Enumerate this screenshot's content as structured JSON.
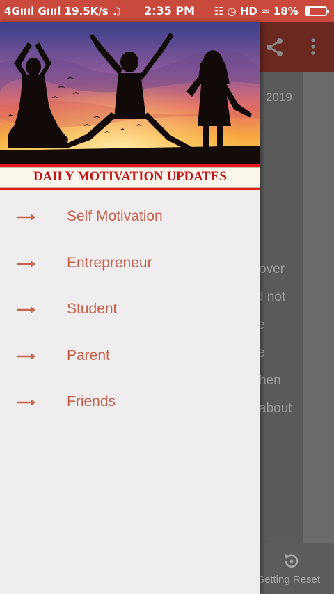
{
  "status_bar": {
    "network_left": "4Gıııl Gıııl 19.5K/s ♫",
    "time": "2:35 PM",
    "indicators": "HD",
    "battery": "18%",
    "battery_level": 0.18
  },
  "background_screen": {
    "date_fragment": "2019",
    "text_fragments": [
      "over",
      "d  not",
      "e",
      "e",
      "hen",
      "about"
    ],
    "bottom_action_label": "Setting Reset"
  },
  "drawer": {
    "banner_title": "DAILY MOTIVATION UPDATES",
    "menu_items": [
      {
        "label": "Self Motivation",
        "icon": "arrow-right-icon"
      },
      {
        "label": "Entrepreneur",
        "icon": "arrow-right-icon"
      },
      {
        "label": "Student",
        "icon": "arrow-right-icon"
      },
      {
        "label": "Parent",
        "icon": "arrow-right-icon"
      },
      {
        "label": "Friends",
        "icon": "arrow-right-icon"
      }
    ]
  },
  "colors": {
    "status_bar": "#c94a3c",
    "toolbar_dimmed": "#6a2920",
    "banner_red": "#e41a1a",
    "banner_text": "#c4121b",
    "menu_text": "#c9604a",
    "drawer_bg": "#efeded"
  }
}
